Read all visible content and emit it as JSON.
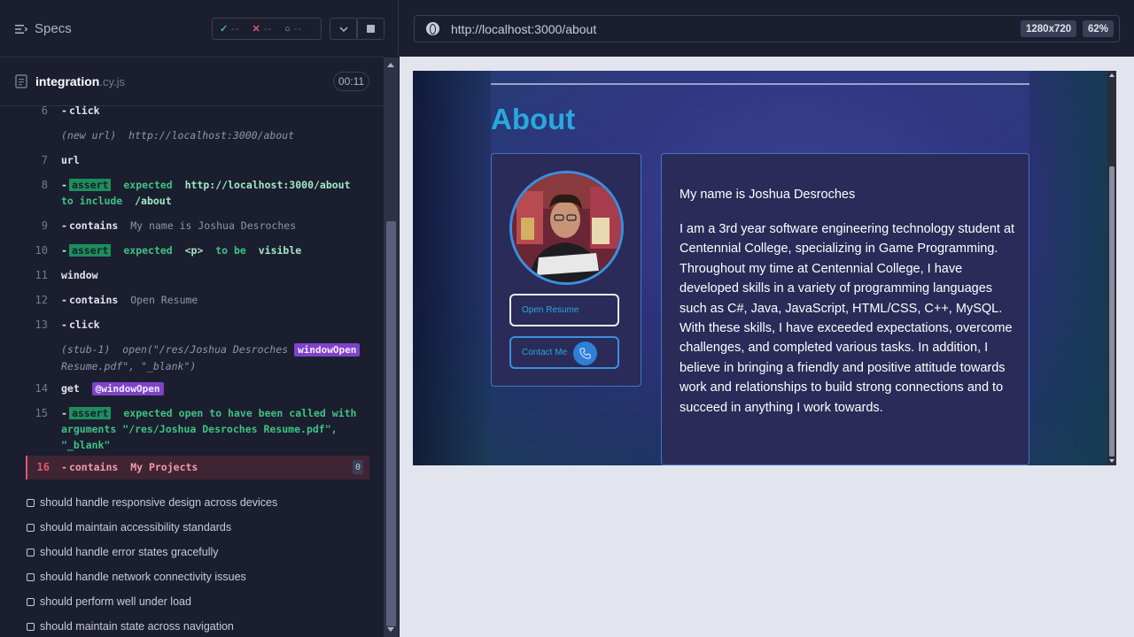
{
  "reporter": {
    "title": "Specs",
    "stats": {
      "passed": "--",
      "failed": "--",
      "pending": "--"
    },
    "file": {
      "name": "integration",
      "ext": ".cy.js",
      "time": "00:11"
    }
  },
  "commands": [
    {
      "num": "6",
      "name": "click"
    },
    {
      "prefix": "(new url)",
      "text": "http://localhost:3000/about"
    },
    {
      "num": "7",
      "name": "url"
    },
    {
      "num": "8",
      "tag": "assert",
      "text": "expected",
      "val": "http://localhost:3000/about",
      "text2": "to include",
      "val2": "/about"
    },
    {
      "num": "9",
      "name": "contains",
      "arg": "My name is Joshua Desroches"
    },
    {
      "num": "10",
      "tag": "assert",
      "text": "expected",
      "val": "<p>",
      "text2": "to be",
      "val2": "visible"
    },
    {
      "num": "11",
      "name": "window"
    },
    {
      "num": "12",
      "name": "contains",
      "arg": "Open Resume"
    },
    {
      "num": "13",
      "name": "click"
    },
    {
      "prefix": "(stub-1)",
      "text": "open(\"/res/Joshua Desroches",
      "alias": "windowOpen",
      "text2": "Resume.pdf\", \"_blank\")"
    },
    {
      "num": "14",
      "name": "get",
      "alias": "@windowOpen"
    },
    {
      "num": "15",
      "tag": "assert",
      "text": "expected open to have been called with arguments \"/res/Joshua Desroches Resume.pdf\", \"_blank\""
    },
    {
      "num": "16",
      "name": "contains",
      "arg": "My Projects",
      "badge": "0"
    }
  ],
  "tests": [
    "should handle responsive design across devices",
    "should maintain accessibility standards",
    "should handle error states gracefully",
    "should handle network connectivity issues",
    "should perform well under load",
    "should maintain state across navigation"
  ],
  "preview": {
    "url": "http://localhost:3000/about",
    "dimensions": "1280x720",
    "zoom": "62%"
  },
  "site": {
    "heading": "About",
    "resume_button": "Open Resume",
    "contact_button": "Contact Me",
    "name_line": "My name is Joshua Desroches",
    "bio": "I am a 3rd year software engineering technology student at Centennial College, specializing in Game Programming. Throughout my time at Centennial College, I have developed skills in a variety of programming languages such as C#, Java, JavaScript, HTML/CSS, C++, MySQL. With these skills, I have exceeded expectations, overcome challenges, and completed various tasks. In addition, I believe in bringing a friendly and positive attitude towards work and relationships to build strong connections and to succeed in anything I work towards."
  },
  "colors": {
    "accent": "#29a8e0",
    "pass": "#3ec285",
    "fail": "#e45770",
    "alias": "#7f43c9"
  }
}
